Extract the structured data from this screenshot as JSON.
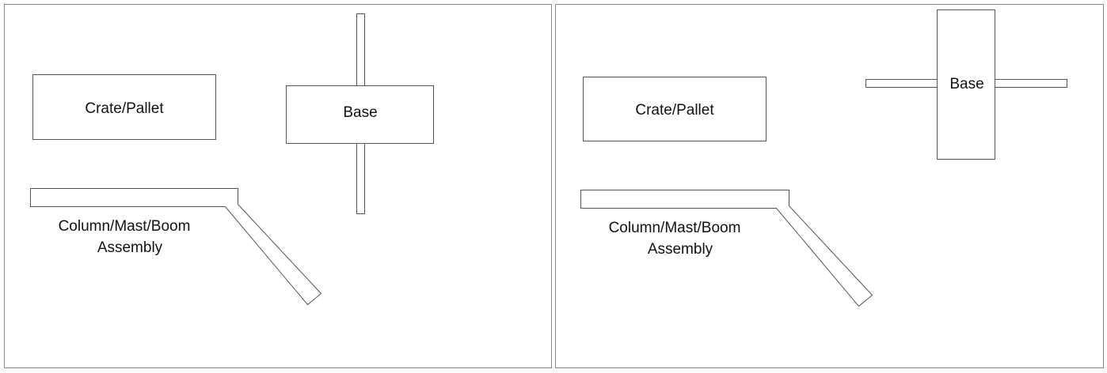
{
  "panels": [
    {
      "crate_label": "Crate/Pallet",
      "base_label": "Base",
      "column_label_line1": "Column/Mast/Boom",
      "column_label_line2": "Assembly"
    },
    {
      "crate_label": "Crate/Pallet",
      "base_label": "Base",
      "column_label_line1": "Column/Mast/Boom",
      "column_label_line2": "Assembly"
    }
  ],
  "colors": {
    "frame": "#888888",
    "outline": "#555555",
    "text": "#111111"
  }
}
